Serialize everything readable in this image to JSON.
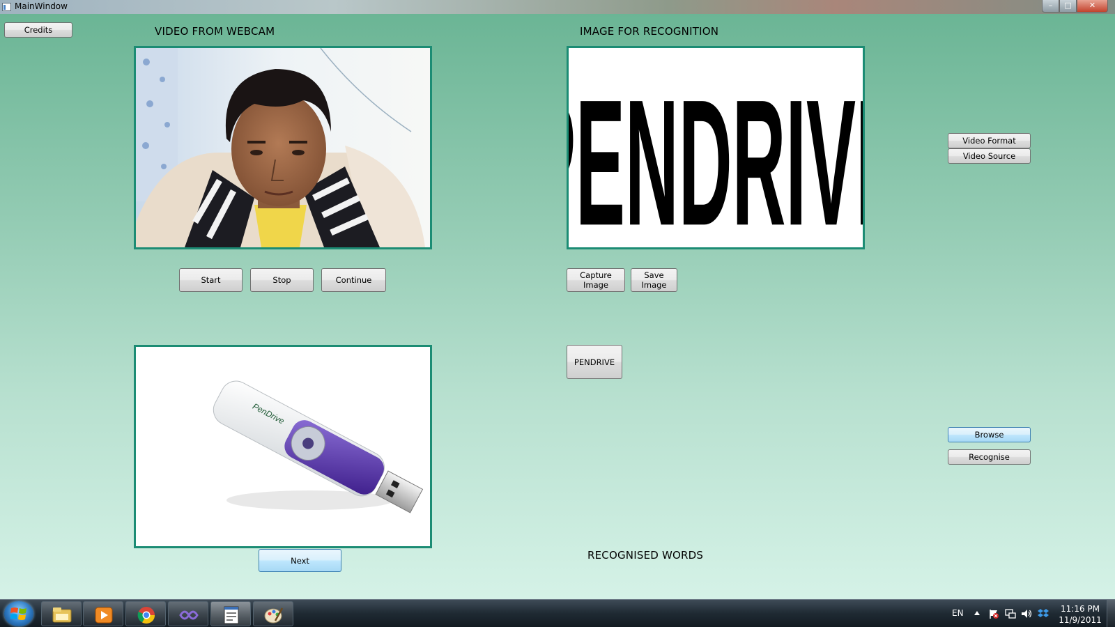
{
  "window": {
    "title": "MainWindow",
    "controls": {
      "minimize": "–",
      "maximize": "□",
      "close": "✕"
    }
  },
  "buttons": {
    "credits": "Credits",
    "start": "Start",
    "stop": "Stop",
    "continue": "Continue",
    "capture_image": "Capture Image",
    "save_image": "Save Image",
    "video_format": "Video Format",
    "video_source": "Video Source",
    "pendrive": "PENDRIVE",
    "browse": "Browse",
    "recognise": "Recognise",
    "next": "Next"
  },
  "labels": {
    "video_from_webcam": "VIDEO FROM WEBCAM",
    "image_for_recognition": "IMAGE FOR RECOGNITION",
    "recognised_words": "RECOGNISED WORDS"
  },
  "recognition_image": {
    "text": "PENDRIVE"
  },
  "product_image": {
    "brand_text": "PenDrive"
  },
  "taskbar": {
    "apps": [
      {
        "icon": "windows-explorer-icon"
      },
      {
        "icon": "media-player-icon"
      },
      {
        "icon": "chrome-icon"
      },
      {
        "icon": "visual-studio-icon"
      },
      {
        "icon": "application-window-icon",
        "active": true
      },
      {
        "icon": "paint-icon"
      }
    ],
    "language": "EN",
    "time": "11:16 PM",
    "date": "11/9/2011"
  },
  "colors": {
    "panel_border": "#1c8c74",
    "background_top": "#6bb595",
    "background_bottom": "#d5f2e7",
    "taskbar": "#1f2a33"
  }
}
